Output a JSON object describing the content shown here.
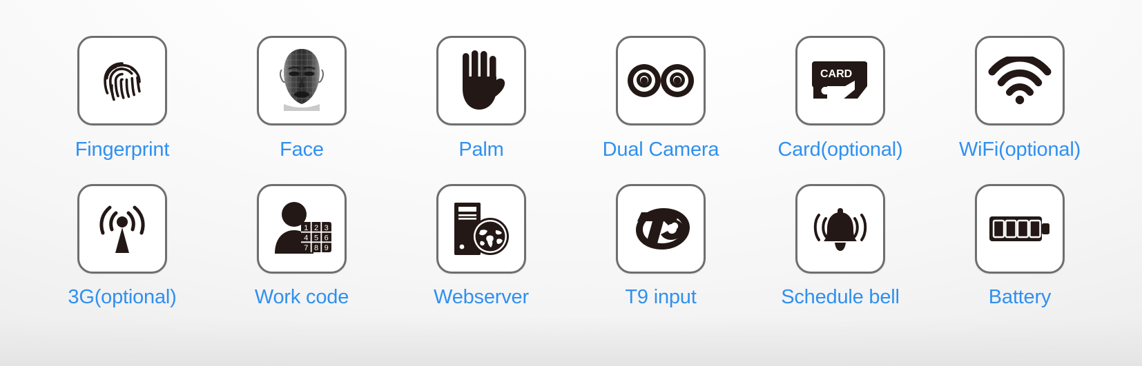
{
  "theme": {
    "label_color": "#2f90f0",
    "tile_border_color": "#6e6e6e",
    "tile_background": "#ffffff",
    "icon_color": "#231815",
    "page_background_top": "#ffffff",
    "page_background_bottom": "#e8e8e8"
  },
  "features": [
    {
      "id": "fingerprint",
      "label": "Fingerprint",
      "icon": "fingerprint-icon",
      "row": 1,
      "col": 1
    },
    {
      "id": "face",
      "label": "Face",
      "icon": "face-mesh-icon",
      "row": 1,
      "col": 2
    },
    {
      "id": "palm",
      "label": "Palm",
      "icon": "palm-hand-icon",
      "row": 1,
      "col": 3
    },
    {
      "id": "dual-camera",
      "label": "Dual Camera",
      "icon": "dual-camera-icon",
      "row": 1,
      "col": 4
    },
    {
      "id": "card",
      "label": "Card(optional)",
      "icon": "card-swipe-icon",
      "row": 1,
      "col": 5
    },
    {
      "id": "wifi",
      "label": "WiFi(optional)",
      "icon": "wifi-icon",
      "row": 1,
      "col": 6
    },
    {
      "id": "3g",
      "label": "3G(optional)",
      "icon": "antenna-signal-icon",
      "row": 2,
      "col": 1
    },
    {
      "id": "work-code",
      "label": "Work code",
      "icon": "user-keypad-icon",
      "row": 2,
      "col": 2
    },
    {
      "id": "webserver",
      "label": "Webserver",
      "icon": "server-globe-icon",
      "row": 2,
      "col": 3
    },
    {
      "id": "t9-input",
      "label": "T9 input",
      "icon": "t9-logo-icon",
      "row": 2,
      "col": 4
    },
    {
      "id": "schedule-bell",
      "label": "Schedule bell",
      "icon": "ringing-bell-icon",
      "row": 2,
      "col": 5
    },
    {
      "id": "battery",
      "label": "Battery",
      "icon": "battery-full-icon",
      "row": 2,
      "col": 6
    }
  ],
  "icon_details": {
    "card_text": "CARD",
    "keypad_keys": [
      "1",
      "2",
      "3",
      "4",
      "5",
      "6",
      "7",
      "8",
      "9"
    ],
    "t9_text": "T9",
    "battery_bars": 4,
    "wifi_arcs": 3,
    "camera_lenses": 2
  }
}
